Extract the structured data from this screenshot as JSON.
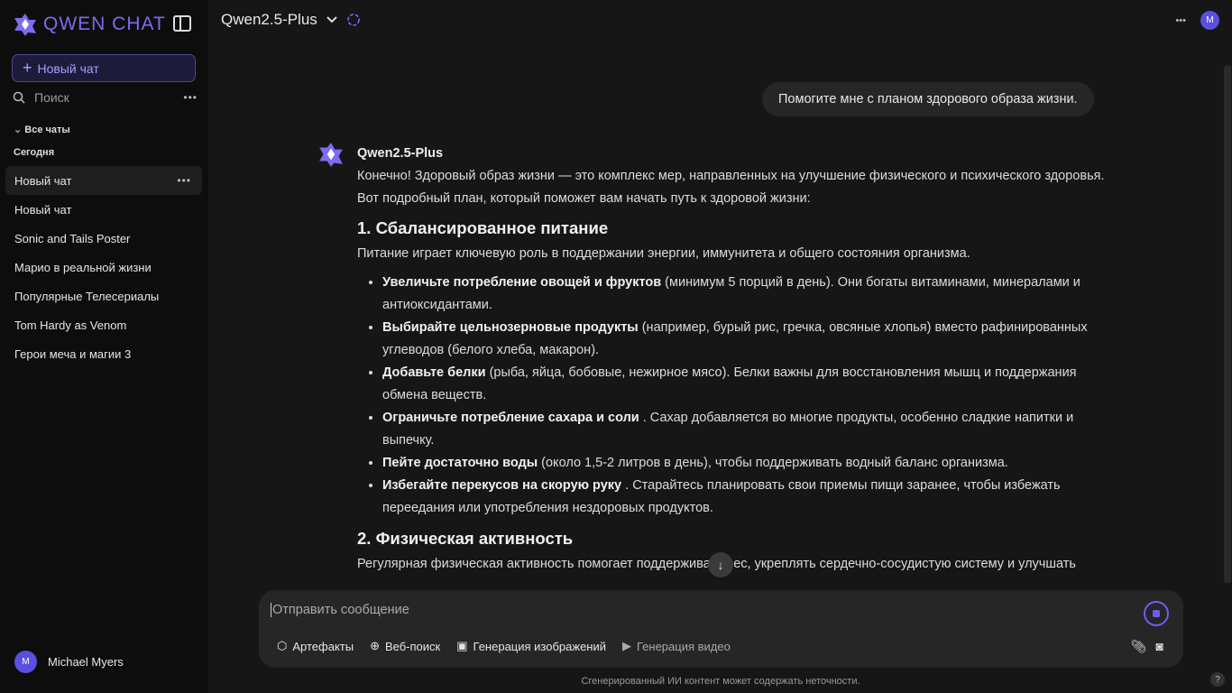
{
  "sidebar": {
    "logo": "QWEN CHAT",
    "new_chat": "Новый чат",
    "search_placeholder": "Поиск",
    "all_chats": "Все чаты",
    "today": "Сегодня",
    "chats": [
      "Новый чат",
      "Новый чат",
      "Sonic and Tails Poster",
      "Марио в реальной жизни",
      "Популярные Телесериалы",
      "Tom Hardy as Venom",
      "Герои меча и магии 3"
    ],
    "user": {
      "initial": "M",
      "name": "Michael Myers"
    }
  },
  "header": {
    "model": "Qwen2.5-Plus",
    "avatar_initial": "M"
  },
  "conversation": {
    "user_message": "Помогите мне с планом здорового образа жизни.",
    "assistant_name": "Qwen2.5-Plus",
    "intro": "Конечно! Здоровый образ жизни — это комплекс мер, направленных на улучшение физического и психического здоровья. Вот подробный план, который поможет вам начать путь к здоровой жизни:",
    "section1": {
      "title": "1. Сбалансированное питание",
      "text": "Питание играет ключевую роль в поддержании энергии, иммунитета и общего состояния организма.",
      "items": [
        {
          "bold": "Увеличьте потребление овощей и фруктов",
          "rest": " (минимум 5 порций в день). Они богаты витаминами, минералами и антиоксидантами."
        },
        {
          "bold": "Выбирайте цельнозерновые продукты",
          "rest": " (например, бурый рис, гречка, овсяные хлопья) вместо рафинированных углеводов (белого хлеба, макарон)."
        },
        {
          "bold": "Добавьте белки",
          "rest": " (рыба, яйца, бобовые, нежирное мясо). Белки важны для восстановления мышц и поддержания обмена веществ."
        },
        {
          "bold": "Ограничьте потребление сахара и соли",
          "rest": " . Сахар добавляется во многие продукты, особенно сладкие напитки и выпечку."
        },
        {
          "bold": "Пейте достаточно воды",
          "rest": " (около 1,5-2 литров в день), чтобы поддерживать водный баланс организма."
        },
        {
          "bold": "Избегайте перекусов на скорую руку",
          "rest": " . Старайтесь планировать свои приемы пищи заранее, чтобы избежать переедания или употребления нездоровых продуктов."
        }
      ]
    },
    "section2": {
      "title": "2. Физическая активность",
      "text": "Регулярная физическая активность помогает поддерживать вес, укреплять сердечно-сосудистую систему и улучшать настроение."
    }
  },
  "composer": {
    "placeholder": "Отправить сообщение",
    "tools": [
      "Артефакты",
      "Веб-поиск",
      "Генерация изображений",
      "Генерация видео"
    ]
  },
  "disclaimer": "Сгенерированный ИИ контент может содержать неточности.",
  "help": "?",
  "colors": {
    "accent": "#6c5ff0",
    "sidebar_bg": "#0d0d0d",
    "main_bg": "#161616"
  }
}
